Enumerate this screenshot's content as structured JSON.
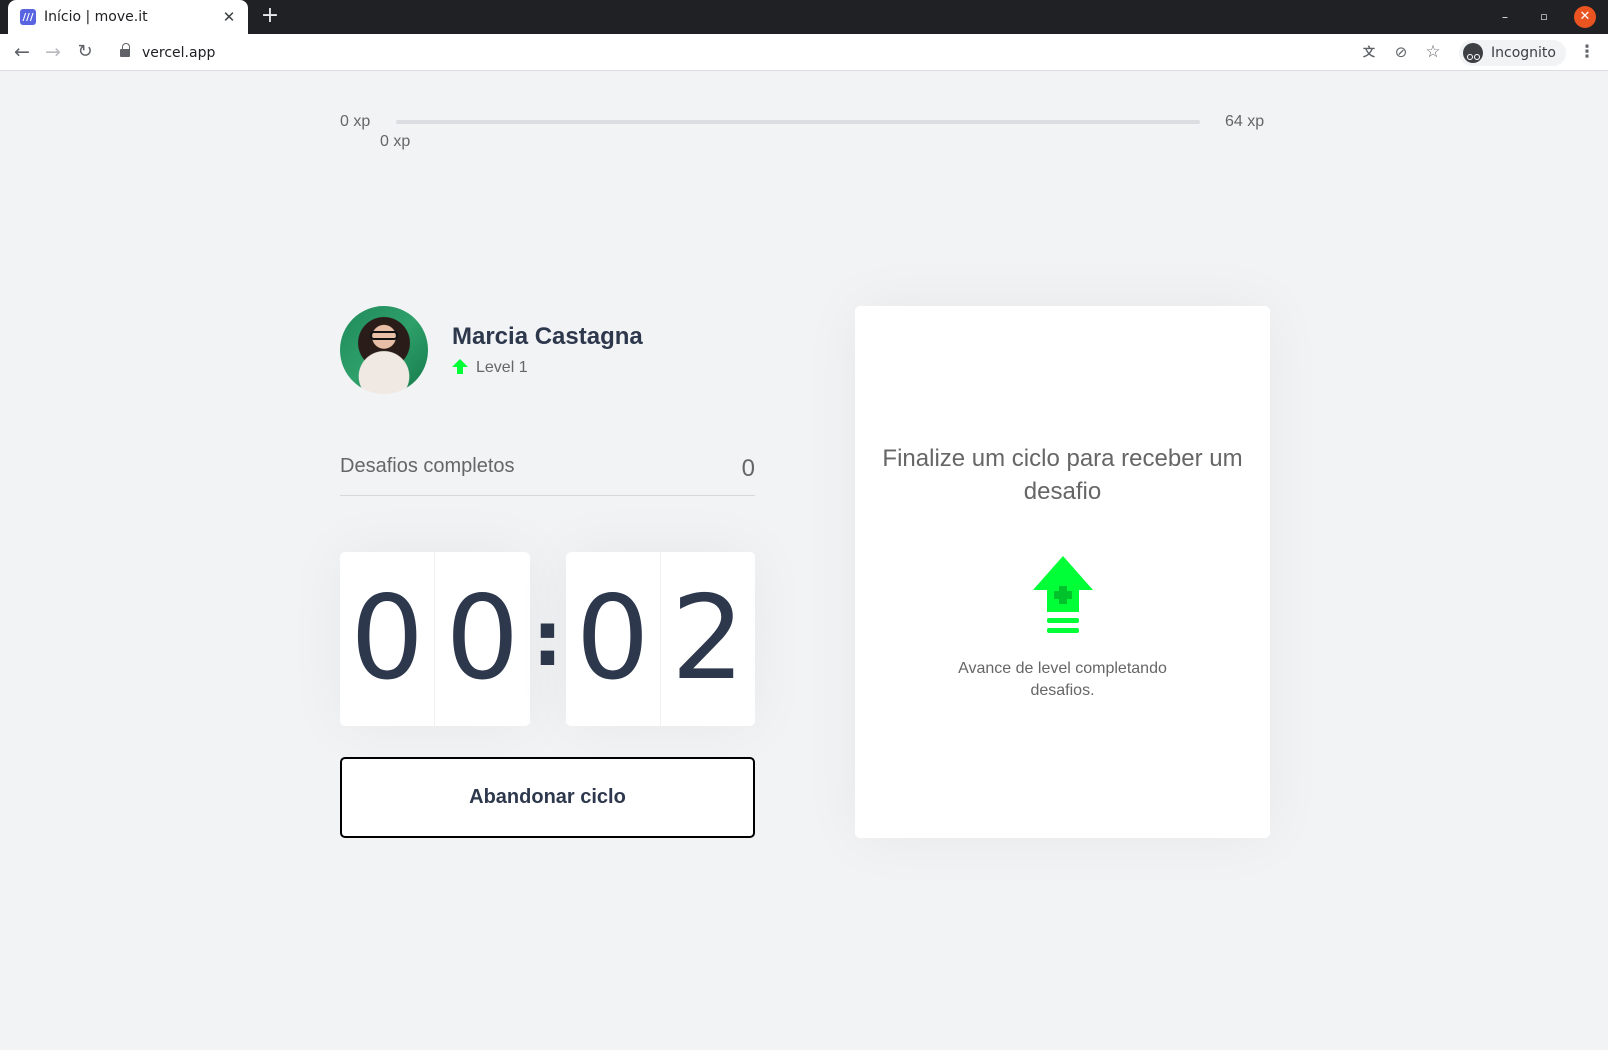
{
  "browser": {
    "tab_title": "Início | move.it",
    "tab_favicon": "///",
    "new_tab": "+",
    "url": "vercel.app",
    "incognito_label": "Incognito",
    "window_controls": {
      "minimize": "–",
      "maximize": "▫",
      "close": "✕"
    }
  },
  "xp": {
    "min_label": "0 xp",
    "current_label": "0 xp",
    "max_label": "64 xp",
    "progress_fraction": 0
  },
  "profile": {
    "name": "Marcia Castagna",
    "level_label": "Level 1"
  },
  "challenges": {
    "label": "Desafios completos",
    "count": "0"
  },
  "countdown": {
    "minute_left": "0",
    "minute_right": "0",
    "separator": ":",
    "second_left": "0",
    "second_right": "2"
  },
  "actions": {
    "abandon_label": "Abandonar ciclo"
  },
  "challenge_box": {
    "title": "Finalize um ciclo para receber um desafio",
    "text": "Avance de level completando desafios."
  },
  "colors": {
    "accent_green": "#00ff37",
    "text_dark": "#2e384d",
    "text_gray": "#666666",
    "background": "#f2f3f5"
  }
}
